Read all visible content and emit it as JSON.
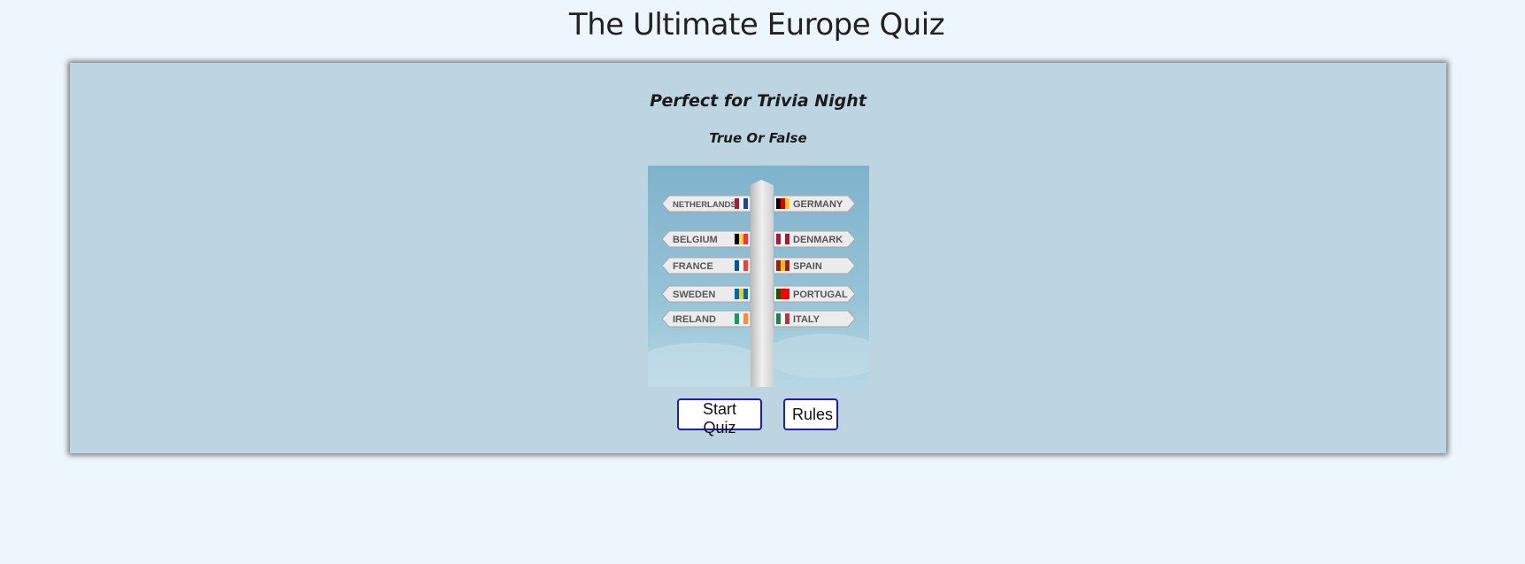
{
  "header": {
    "title": "The Ultimate Europe Quiz"
  },
  "intro": {
    "tagline": "Perfect for Trivia Night",
    "format": "True Or False"
  },
  "image": {
    "icon": "signpost-icon",
    "signs_left": [
      "NETHERLANDS",
      "BELGIUM",
      "FRANCE",
      "SWEDEN",
      "IRELAND"
    ],
    "signs_right": [
      "GERMANY",
      "DENMARK",
      "SPAIN",
      "PORTUGAL",
      "ITALY"
    ]
  },
  "actions": {
    "start_label": "Start Quiz",
    "rules_label": "Rules"
  },
  "colors": {
    "page_bg": "#eef6fd",
    "panel_bg": "#bdd5e1",
    "button_border": "#1d1dbf"
  }
}
